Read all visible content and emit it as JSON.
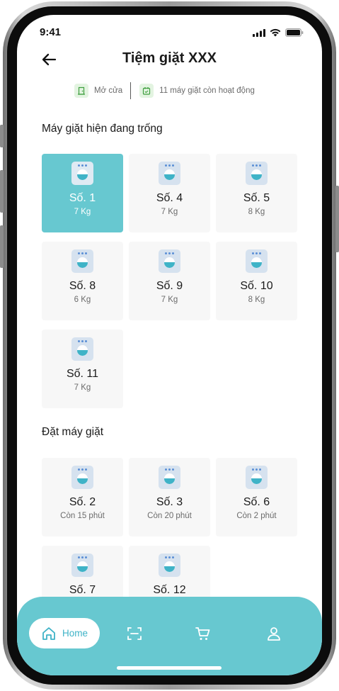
{
  "status_bar": {
    "time": "9:41"
  },
  "header": {
    "title": "Tiệm giặt XXX",
    "back_icon": "arrow-left-icon"
  },
  "info": {
    "open_status": "Mở cửa",
    "active_machines": "11 máy giặt còn hoạt động"
  },
  "available": {
    "title": "Máy giặt hiện đang trống",
    "selected_index": 0,
    "items": [
      {
        "name": "Số. 1",
        "capacity": "7 Kg"
      },
      {
        "name": "Số. 4",
        "capacity": "7 Kg"
      },
      {
        "name": "Số. 5",
        "capacity": "8 Kg"
      },
      {
        "name": "Số. 8",
        "capacity": "6 Kg"
      },
      {
        "name": "Số. 9",
        "capacity": "7 Kg"
      },
      {
        "name": "Số. 10",
        "capacity": "8 Kg"
      },
      {
        "name": "Số. 11",
        "capacity": "7 Kg"
      }
    ]
  },
  "booking": {
    "title": "Đặt máy giặt",
    "items": [
      {
        "name": "Số. 2",
        "remaining": "Còn 15 phút"
      },
      {
        "name": "Số. 3",
        "remaining": "Còn 20 phút"
      },
      {
        "name": "Số. 6",
        "remaining": "Còn 2 phút"
      },
      {
        "name": "Số. 7",
        "remaining": ""
      },
      {
        "name": "Số. 12",
        "remaining": ""
      }
    ]
  },
  "nav": {
    "home_label": "Home",
    "icons": [
      "home-icon",
      "scan-icon",
      "cart-icon",
      "user-icon"
    ]
  },
  "colors": {
    "accent": "#67c8d0",
    "card_bg": "#f7f7f7",
    "info_icon_bg": "#e3f4e1"
  }
}
